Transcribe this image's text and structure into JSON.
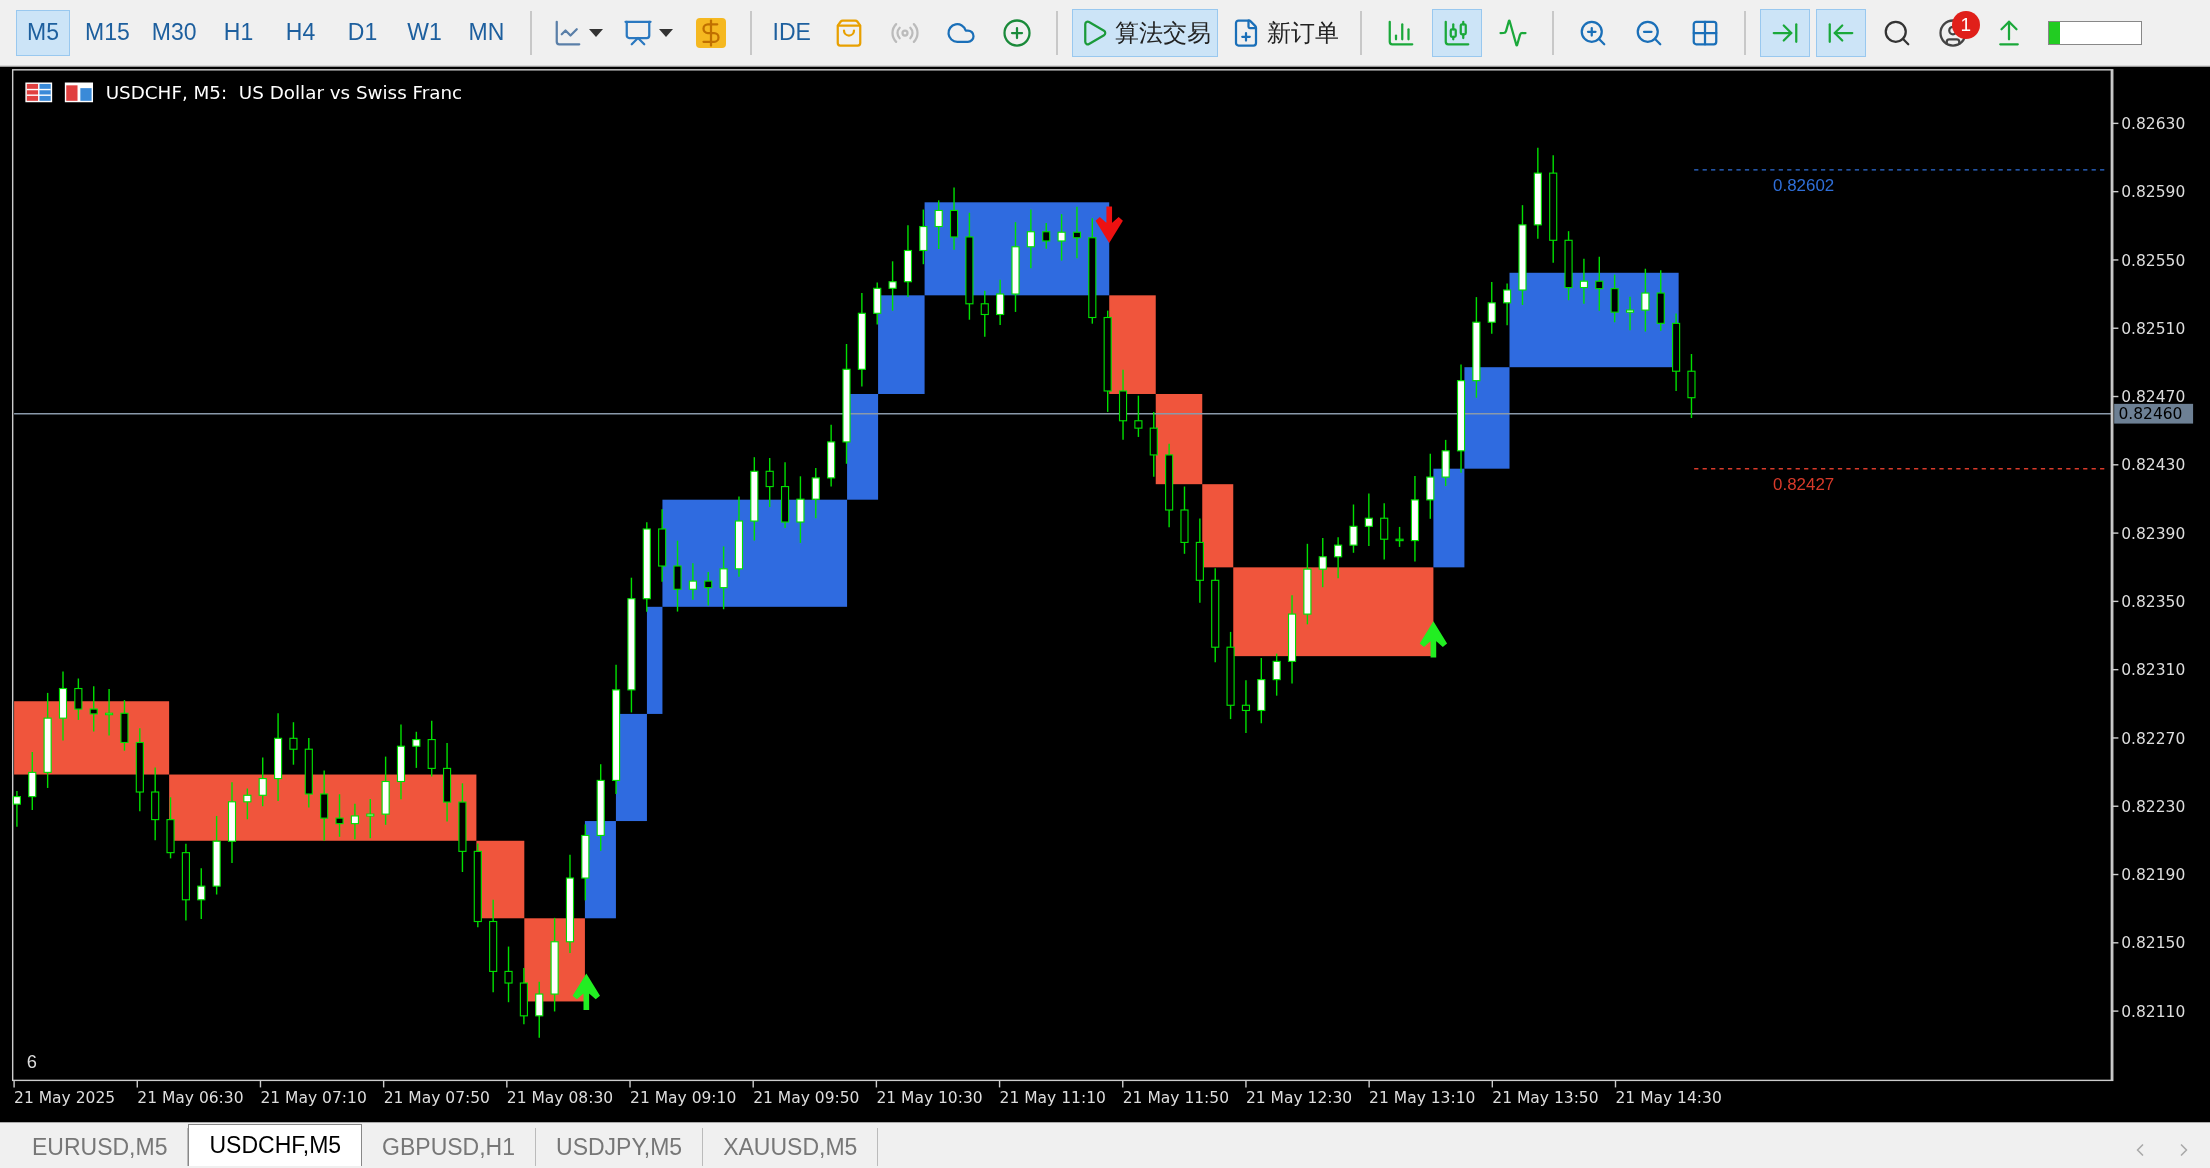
{
  "toolbar": {
    "timeframes": [
      {
        "label": "M5",
        "selected": true
      },
      {
        "label": "M15",
        "selected": false
      },
      {
        "label": "M30",
        "selected": false
      },
      {
        "label": "H1",
        "selected": false
      },
      {
        "label": "H4",
        "selected": false
      },
      {
        "label": "D1",
        "selected": false
      },
      {
        "label": "W1",
        "selected": false
      },
      {
        "label": "MN",
        "selected": false
      }
    ],
    "ide": "IDE",
    "algo_trading": {
      "label": "算法交易",
      "on": true
    },
    "new_order": "新订单",
    "chart_types": [
      {
        "on": false
      },
      {
        "on": true
      },
      {
        "on": false
      }
    ],
    "chart_scroll": [
      {
        "on": true
      },
      {
        "on": true
      }
    ],
    "notifications": "1",
    "progress": {
      "level": 0.12
    }
  },
  "chart": {
    "title": "USDCHF, M5:  US Dollar vs Swiss Franc",
    "price_ticks": [
      "0.82630",
      "0.82590",
      "0.82550",
      "0.82510",
      "0.82470",
      "0.82430",
      "0.82390",
      "0.82350",
      "0.82310",
      "0.82270",
      "0.82230",
      "0.82190",
      "0.82150",
      "0.82110"
    ],
    "current_price": "0.82460",
    "levels": [
      {
        "label": "0.82602",
        "color": "#2f6fd8"
      },
      {
        "label": "0.82427",
        "color": "#d83a2a"
      }
    ],
    "subwindow_label": "6",
    "time_labels": [
      "21 May 2025",
      "21 May 06:30",
      "21 May 07:10",
      "21 May 07:50",
      "21 May 08:30",
      "21 May 09:10",
      "21 May 09:50",
      "21 May 10:30",
      "21 May 11:10",
      "21 May 11:50",
      "21 May 12:30",
      "21 May 13:10",
      "21 May 13:50",
      "21 May 14:30"
    ]
  },
  "tabs": [
    {
      "label": "EURUSD,M5",
      "selected": false
    },
    {
      "label": "USDCHF,M5",
      "selected": true
    },
    {
      "label": "GBPUSD,H1",
      "selected": false
    },
    {
      "label": "USDJPY,M5",
      "selected": false
    },
    {
      "label": "XAUUSD,M5",
      "selected": false
    }
  ]
}
